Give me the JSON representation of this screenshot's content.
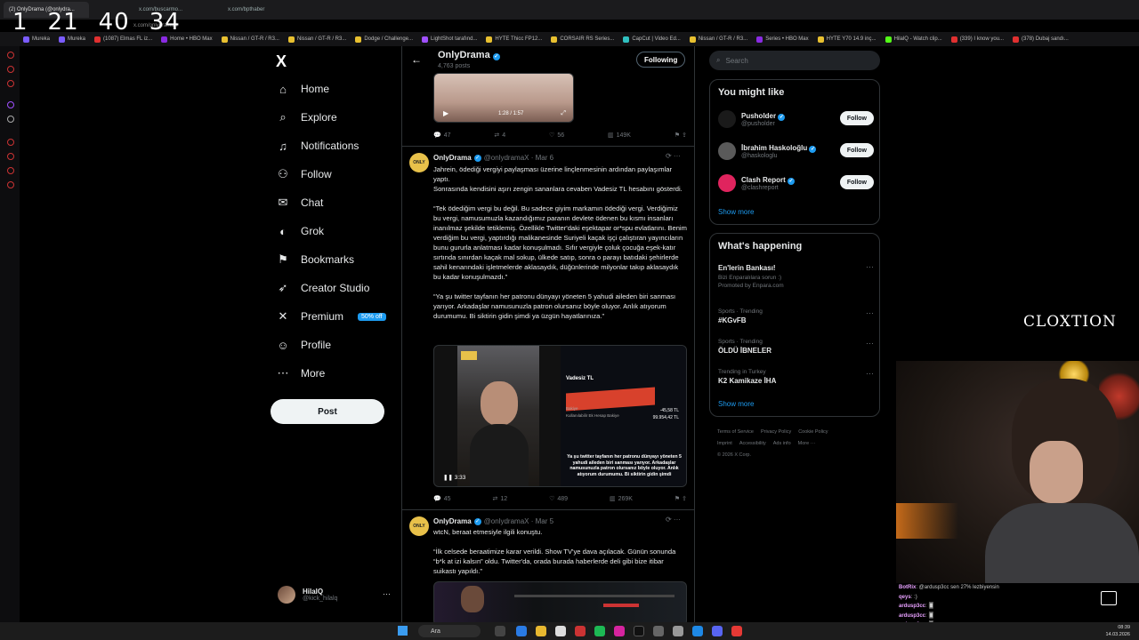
{
  "timer": [
    "1",
    "21",
    "40",
    "34"
  ],
  "browser": {
    "tabs": [
      "(2) OnlyDrama (@onlydra...",
      "x.com/buscarmo...",
      "x.com/bpthaber"
    ],
    "address": "x.com/onlydramaX",
    "bookmarks": [
      "Mureka",
      "Mureka",
      "(1087) Elmas FL iz...",
      "Home • HBO Max",
      "Nissan / GT-R / R3...",
      "Nissan / GT-R / R3...",
      "Dodge / Challenge...",
      "LightShot tarafınd...",
      "HYTE Thicc FP12...",
      "CORSAIR RS Series...",
      "CapCut | Video Ed...",
      "Nissan / GT-R / R3...",
      "Series • HBO Max",
      "HYTE Y70 14.9 inç...",
      "HilalQ - Watch clip...",
      "(339) I know you...",
      "(378) Dubaj sandı..."
    ],
    "bookmark_colors": [
      "#7b5cff",
      "#7b5cff",
      "#e03030",
      "#8a2be2",
      "#e8c030",
      "#e8c030",
      "#e8c030",
      "#a050ff",
      "#e8c030",
      "#e8c030",
      "#30c0c0",
      "#e8c030",
      "#8a2be2",
      "#e8c030",
      "#53fc18",
      "#e03030",
      "#e03030"
    ]
  },
  "sidebar": {
    "logo": "X",
    "items": [
      {
        "label": "Home",
        "icon": "home-icon",
        "glyph": "⌂"
      },
      {
        "label": "Explore",
        "icon": "search-icon",
        "glyph": "⌕"
      },
      {
        "label": "Notifications",
        "icon": "bell-icon",
        "glyph": "♫"
      },
      {
        "label": "Follow",
        "icon": "person-add-icon",
        "glyph": "⚇"
      },
      {
        "label": "Chat",
        "icon": "mail-icon",
        "glyph": "✉"
      },
      {
        "label": "Grok",
        "icon": "grok-icon",
        "glyph": "◐"
      },
      {
        "label": "Bookmarks",
        "icon": "bookmark-icon",
        "glyph": "⚑"
      },
      {
        "label": "Creator Studio",
        "icon": "rocket-icon",
        "glyph": "➶"
      },
      {
        "label": "Premium",
        "icon": "x-premium-icon",
        "glyph": "✕"
      },
      {
        "label": "Profile",
        "icon": "person-icon",
        "glyph": "☺"
      },
      {
        "label": "More",
        "icon": "more-circle-icon",
        "glyph": "⋯"
      }
    ],
    "premium_badge": "50% off",
    "post_button": "Post",
    "user_name": "HilalQ",
    "user_handle": "@kick_hilalq"
  },
  "profile": {
    "name": "OnlyDrama",
    "posts": "4,763 posts",
    "following_button": "Following"
  },
  "tweets": {
    "first_video_time": "1:28 / 1:57",
    "first_actions": [
      "47",
      "4",
      "56",
      "149K"
    ],
    "t1": {
      "name": "OnlyDrama",
      "handle": "@onlydramaX · Mar 6",
      "p1": "Jahrein, ödediği vergiyi paylaşması üzerine linçlenmesinin ardından paylaşımlar yaptı.\nSonrasında kendisini aşırı zengin sananlara cevaben Vadesiz TL hesabını gösterdi.",
      "p2": "“Tek ödediğim vergi bu değil. Bu sadece giyim markamın ödediği vergi. Verdiğimiz bu vergi, namusumuzla kazandığımız paranın devlete ödenen bu kısmı insanları inanılmaz şekilde tetiklemiş. Özellikle Twitter'daki eşektapar or*spu evlatlarını. Benim verdiğim bu vergi, yaptırdığı malikanesinde Suriyeli kaçak işçi çalıştıran yayıncıların bunu gururla anlatması kadar konuşulmadı. Sıfır vergiyle çoluk çocuğa eşek-katır sırtında sınırdan kaçak mal sokup, ülkede satıp, sonra o parayı batıdaki şehirlerde sahil kenarındaki işletmelerde aklasaydık, düğünlerinde milyonlar takıp aklasaydık bu kadar konuşulmazdı.”",
      "p3": "“Ya şu twitter tayfanın her patronu dünyayı yöneten 5 yahudi aileden biri sanması yarıyor. Arkadaşlar namusunuzla patron olursanız böyle oluyor. Anlık atıyorum durumumu. Bi siktirin gidin şimdi ya üzgün hayatlarınıza.”",
      "video_time": "3:33",
      "video_caption": "Ya şu twitter tayfanın her patronu dünyayı yöneten 5 yahudi aileden biri sanması yarıyor. Arkadaşlar namusunuzla patron olursanız böyle oluyor. Anlık atıyorum durumumu. Bi siktirin gidin şimdi",
      "bank_title": "Vadesiz TL",
      "bank_rows": [
        "Bakiye",
        "Kullanılabilir Ek Hesap Bakiye"
      ],
      "bank_values": [
        "-45,58 TL",
        "99.954,42 TL"
      ],
      "actions": [
        "45",
        "12",
        "489",
        "269K"
      ]
    },
    "t2": {
      "name": "OnlyDrama",
      "handle": "@onlydramaX · Mar 5",
      "p1": "wtcN, beraat etmesiyle ilgili konuştu.",
      "p2": "“İlk celsede beraatimize karar verildi. Show TV'ye dava açılacak. Günün sonunda “b*k at izi kalsın” oldu. Twitter'da, orada burada haberlerde deli gibi bize itibar suikastı yapıldı.”"
    }
  },
  "right": {
    "search_placeholder": "Search",
    "you_might_like": "You might like",
    "suggestions": [
      {
        "name": "Pusholder",
        "handle": "@pusholder",
        "color": "#1a1a1a"
      },
      {
        "name": "İbrahim Haskoloğlu",
        "handle": "@haskologlu",
        "color": "#5a5a5a"
      },
      {
        "name": "Clash Report",
        "handle": "@clashreport",
        "color": "#e0245e"
      }
    ],
    "follow_label": "Follow",
    "show_more": "Show more",
    "whats_happening": "What's happening",
    "trends": [
      {
        "ctx": "Bizi Enparalılara sorun :)",
        "title": "En'lerin Bankası!",
        "extra": "Promoted by Enpara.com",
        "promoted": true
      },
      {
        "ctx": "Sports · Trending",
        "title": "#KGvFB"
      },
      {
        "ctx": "Sports · Trending",
        "title": "ÖLDÜ İBNELER"
      },
      {
        "ctx": "Trending in Turkey",
        "title": "K2 Kamikaze İHA"
      }
    ],
    "footer": [
      "Terms of Service",
      "Privacy Policy",
      "Cookie Policy",
      "Imprint",
      "Accessibility",
      "Ads info",
      "More ···",
      "© 2026 X Corp."
    ]
  },
  "stream": {
    "brand": "CLOXTION",
    "chat": [
      {
        "user": "BotRix",
        "msg": ": @ardusp3cc sen 27% lezbiyensin"
      },
      {
        "user": "qeys",
        "msg": ": :)"
      },
      {
        "user": "ardusp3cc",
        "msg": ": 🂠"
      },
      {
        "user": "ardusp3cc",
        "msg": ": 🂠"
      },
      {
        "user": "ardusp3cc",
        "msg": ": 🂠"
      }
    ]
  },
  "taskbar": {
    "search": "Ara",
    "time": "08:39",
    "date": "14.03.2026"
  }
}
